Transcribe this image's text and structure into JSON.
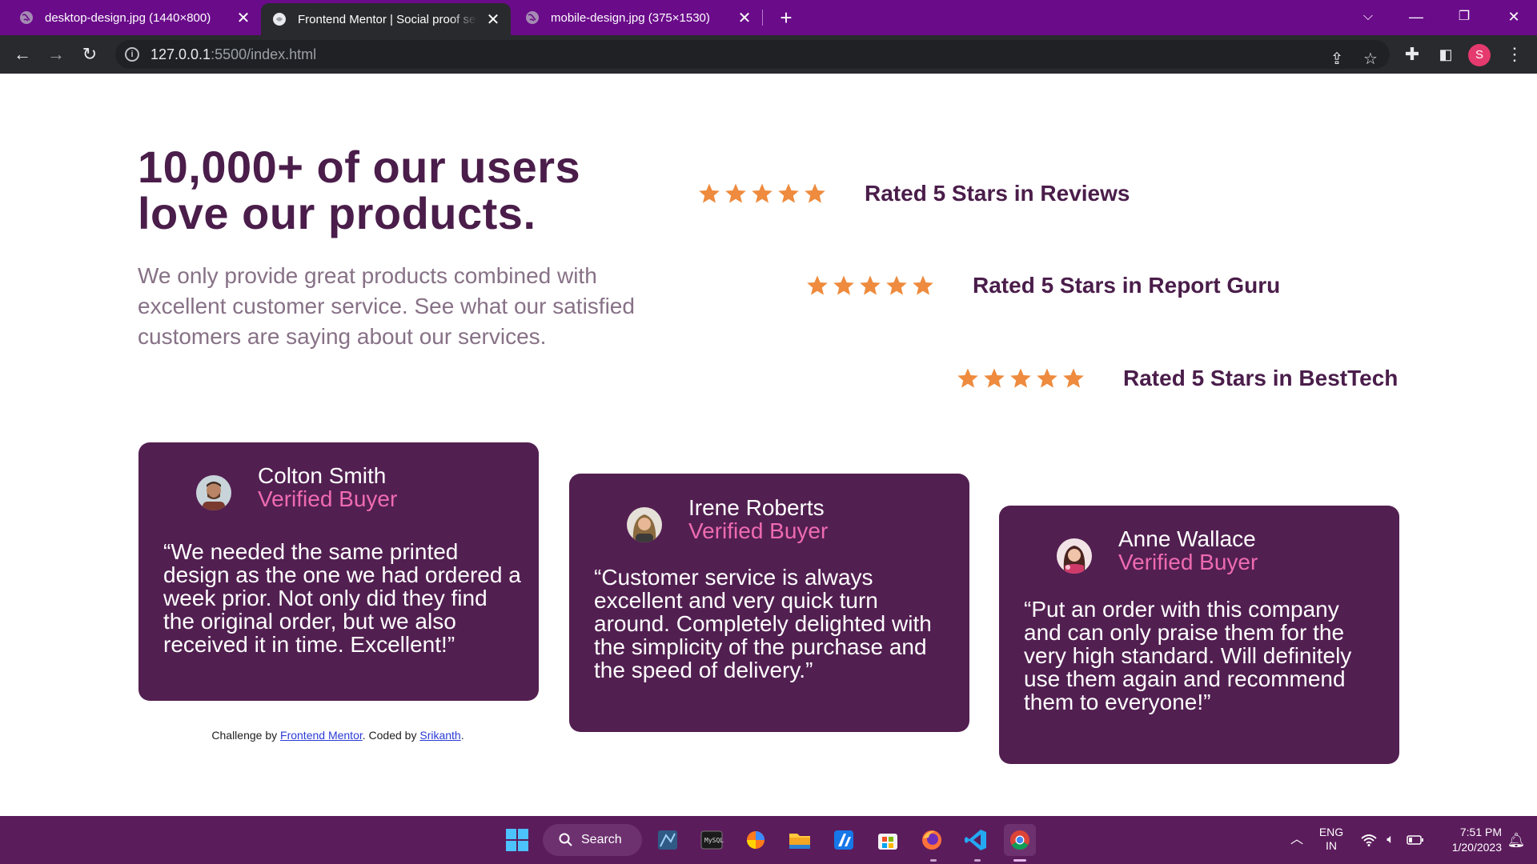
{
  "browser": {
    "tabs": [
      {
        "title": "desktop-design.jpg (1440×800)",
        "active": false
      },
      {
        "title": "Frontend Mentor | Social proof section",
        "active": true
      },
      {
        "title": "mobile-design.jpg (375×1530)",
        "active": false
      }
    ],
    "url_host": "127.0.0.1",
    "url_rest": ":5500/index.html",
    "profile_initial": "S",
    "accent": "#6a0b8a"
  },
  "hero": {
    "title": "10,000+ of our users love our products.",
    "description": "We only provide great products combined with excellent customer service. See what our satisfied customers are saying about our services."
  },
  "ratings": [
    {
      "text": "Rated 5 Stars in Reviews",
      "stars": 5
    },
    {
      "text": "Rated 5 Stars in Report Guru",
      "stars": 5
    },
    {
      "text": "Rated 5 Stars in BestTech",
      "stars": 5
    }
  ],
  "testimonials": [
    {
      "name": "Colton Smith",
      "role": "Verified Buyer",
      "quote": "“We needed the same printed design as the one we had ordered a week prior. Not only did they find the original order, but we also received it in time. Excellent!”"
    },
    {
      "name": "Irene Roberts",
      "role": "Verified Buyer",
      "quote": "“Customer service is always excellent and very quick turn around. Completely delighted with the simplicity of the purchase and the speed of delivery.”"
    },
    {
      "name": "Anne Wallace",
      "role": "Verified Buyer",
      "quote": "“Put an order with this company and can only praise them for the very high standard. Will definitely use them again and recommend them to everyone!”"
    }
  ],
  "attribution": {
    "prefix": "Challenge by ",
    "link1": "Frontend Mentor",
    "middle": ". Coded by ",
    "link2": "Srikanth",
    "suffix": "."
  },
  "taskbar": {
    "search_label": "Search",
    "lang_line1": "ENG",
    "lang_line2": "IN",
    "time": "7:51 PM",
    "date": "1/20/2023"
  },
  "colors": {
    "heading": "#4a1d4a",
    "star": "#ee8b3e",
    "card": "#521f51",
    "role": "#ee6bb0",
    "taskbar": "#5b1c5c"
  }
}
